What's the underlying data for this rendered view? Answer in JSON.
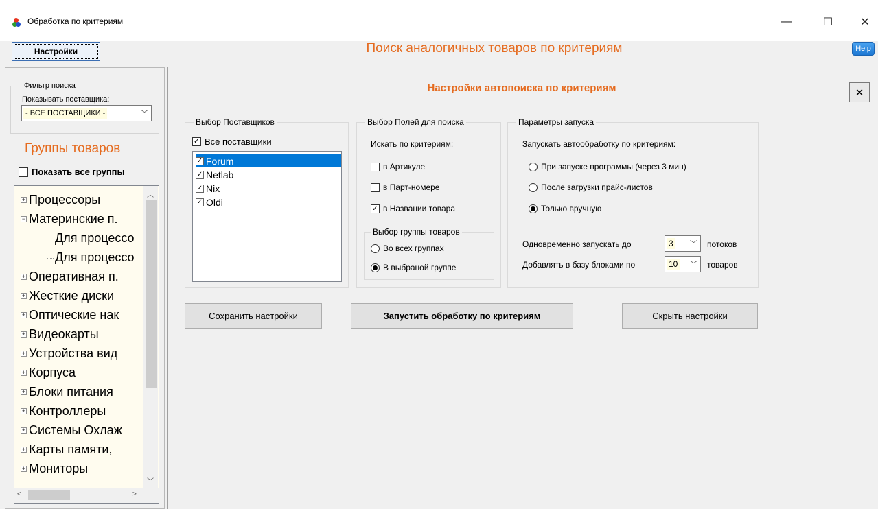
{
  "window": {
    "title": "Обработка по критериям",
    "controls": {
      "minimize": "—",
      "maximize": "☐",
      "close": "✕"
    }
  },
  "toolbar": {
    "settings_label": "Настройки",
    "main_title": "Поиск аналогичных товаров по критериям",
    "help_label": "Help"
  },
  "left": {
    "filter_legend": "Фильтр поиска",
    "supplier_label": "Показывать поставщика:",
    "supplier_value": "- ВСЕ ПОСТАВЩИКИ -",
    "groups_title": "Группы товаров",
    "show_all_label": "Показать все группы",
    "show_all_checked": false,
    "tree": [
      {
        "label": "Процессоры",
        "level": 0,
        "expander": "+"
      },
      {
        "label": "Материнские п.",
        "level": 0,
        "expander": "−"
      },
      {
        "label": "Для процессо",
        "level": 1
      },
      {
        "label": "Для процессо",
        "level": 1
      },
      {
        "label": "Оперативная п.",
        "level": 0,
        "expander": "+"
      },
      {
        "label": "Жесткие  диски",
        "level": 0,
        "expander": "+"
      },
      {
        "label": "Оптические нак",
        "level": 0,
        "expander": "+"
      },
      {
        "label": "Видеокарты",
        "level": 0,
        "expander": "+"
      },
      {
        "label": "Устройства вид",
        "level": 0,
        "expander": "+"
      },
      {
        "label": "Корпуса",
        "level": 0,
        "expander": "+"
      },
      {
        "label": "Блоки питания",
        "level": 0,
        "expander": "+"
      },
      {
        "label": "Контроллеры",
        "level": 0,
        "expander": "+"
      },
      {
        "label": "Системы Охлаж",
        "level": 0,
        "expander": "+"
      },
      {
        "label": "Карты памяти,",
        "level": 0,
        "expander": "+"
      },
      {
        "label": "Мониторы",
        "level": 0,
        "expander": "+"
      }
    ]
  },
  "settings": {
    "title": "Настройки автопоиска по критериям",
    "close_label": "✕",
    "suppliers": {
      "legend": "Выбор Поставщиков",
      "all_label": "Все поставщики",
      "all_checked": true,
      "items": [
        {
          "label": "Forum",
          "checked": true,
          "selected": true
        },
        {
          "label": "Netlab",
          "checked": true,
          "selected": false
        },
        {
          "label": "Nix",
          "checked": true,
          "selected": false
        },
        {
          "label": "Oldi",
          "checked": true,
          "selected": false
        }
      ]
    },
    "fields": {
      "legend": "Выбор Полей для поиска",
      "search_by_label": "Искать по критериям:",
      "options": [
        {
          "label": "в Артикуле",
          "checked": false
        },
        {
          "label": "в Парт-номере",
          "checked": false
        },
        {
          "label": "в Названии товара",
          "checked": true
        }
      ],
      "group_legend": "Выбор группы товаров",
      "group_options": [
        {
          "label": "Во всех группах",
          "selected": false
        },
        {
          "label": "В выбраной группе",
          "selected": true
        }
      ]
    },
    "launch": {
      "legend": "Параметры запуска",
      "run_label": "Запускать автообработку по критериям:",
      "run_options": [
        {
          "label": "При запуске программы (через 3 мин)",
          "selected": false
        },
        {
          "label": "После загрузки прайс-листов",
          "selected": false
        },
        {
          "label": "Только вручную",
          "selected": true
        }
      ],
      "threads_label": "Одновременно запускать до",
      "threads_value": "3",
      "threads_unit": "потоков",
      "blocks_label": "Добавлять в базу блоками по",
      "blocks_value": "10",
      "blocks_unit": "товаров"
    },
    "buttons": {
      "save": "Сохранить настройки",
      "run": "Запустить обработку по критериям",
      "hide": "Скрыть настройки"
    }
  }
}
